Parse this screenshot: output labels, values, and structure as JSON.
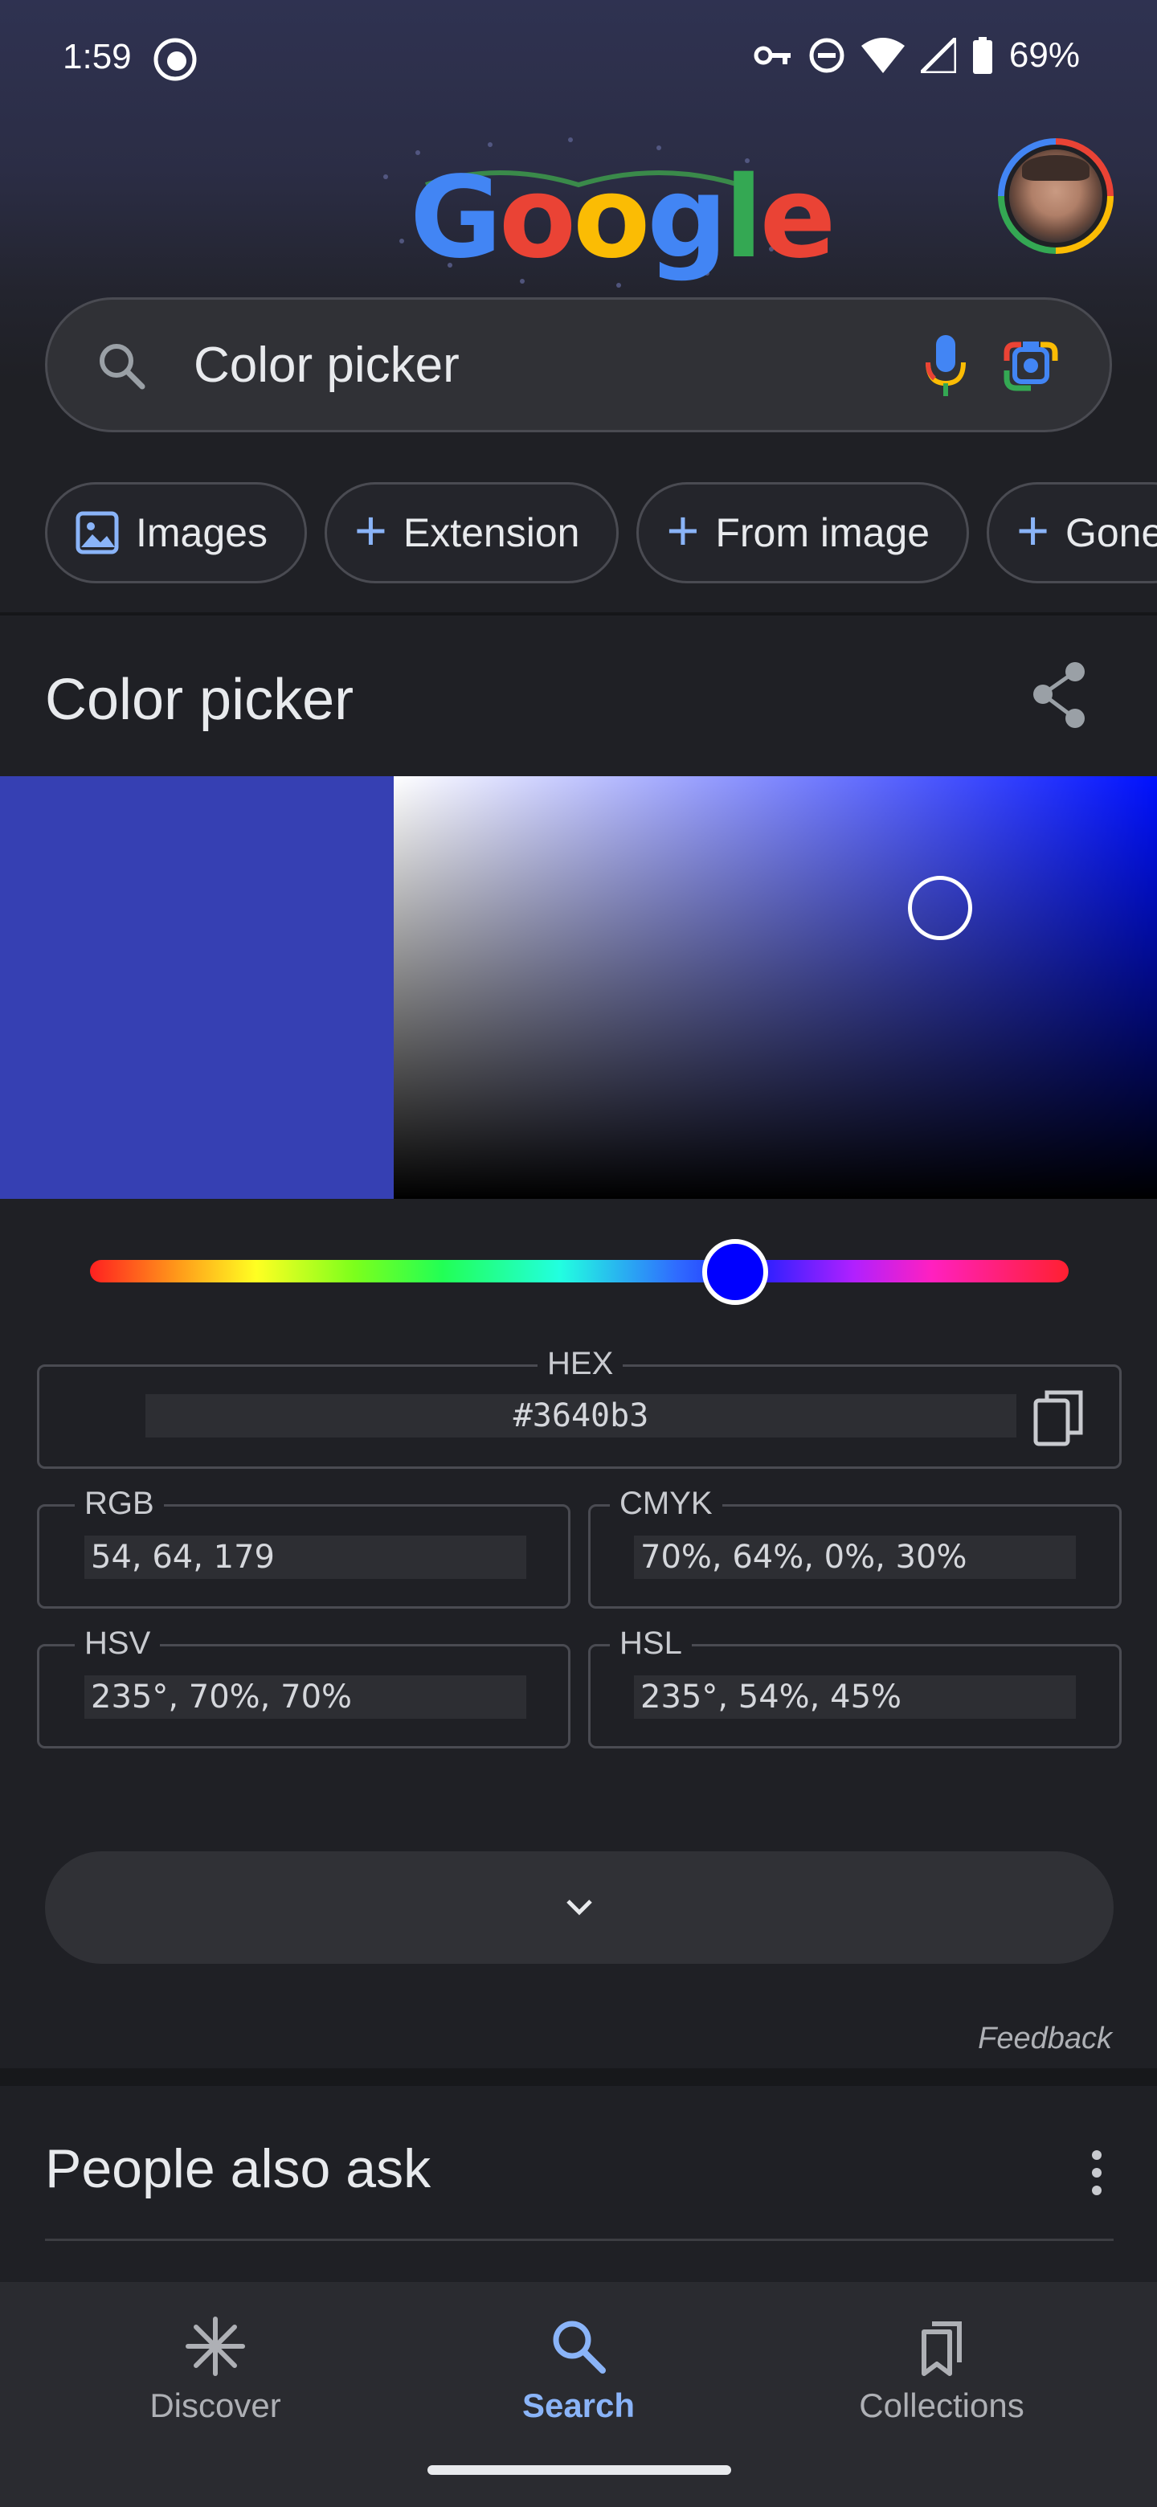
{
  "status_bar": {
    "time": "1:59",
    "battery": "69%",
    "icons": [
      "vpn-key-icon",
      "do-not-disturb-icon",
      "wifi-icon",
      "signal-icon",
      "battery-icon"
    ]
  },
  "logo": "Google",
  "search": {
    "query": "Color picker"
  },
  "chips": [
    {
      "label": "Images",
      "icon": "image-icon"
    },
    {
      "label": "Extension",
      "icon": "plus-icon"
    },
    {
      "label": "From image",
      "icon": "plus-icon"
    },
    {
      "label": "Gone",
      "icon": "plus-icon"
    }
  ],
  "color_picker": {
    "title": "Color picker",
    "selected_color": "#3640b3",
    "hue_position": 0.66,
    "hex": {
      "label": "HEX",
      "value": "#3640b3"
    },
    "rgb": {
      "label": "RGB",
      "value": "54, 64, 179"
    },
    "cmyk": {
      "label": "CMYK",
      "value": "70%, 64%, 0%, 30%"
    },
    "hsv": {
      "label": "HSV",
      "value": "235°, 70%, 70%"
    },
    "hsl": {
      "label": "HSL",
      "value": "235°, 54%, 45%"
    },
    "feedback": "Feedback"
  },
  "people_also_ask": {
    "title": "People also ask"
  },
  "bottom_nav": [
    {
      "label": "Discover",
      "icon": "asterisk-icon",
      "active": false
    },
    {
      "label": "Search",
      "icon": "search-icon",
      "active": true
    },
    {
      "label": "Collections",
      "icon": "collections-icon",
      "active": false
    }
  ],
  "colors": {
    "accent": "#8ab4f8",
    "background": "#1f2025"
  }
}
